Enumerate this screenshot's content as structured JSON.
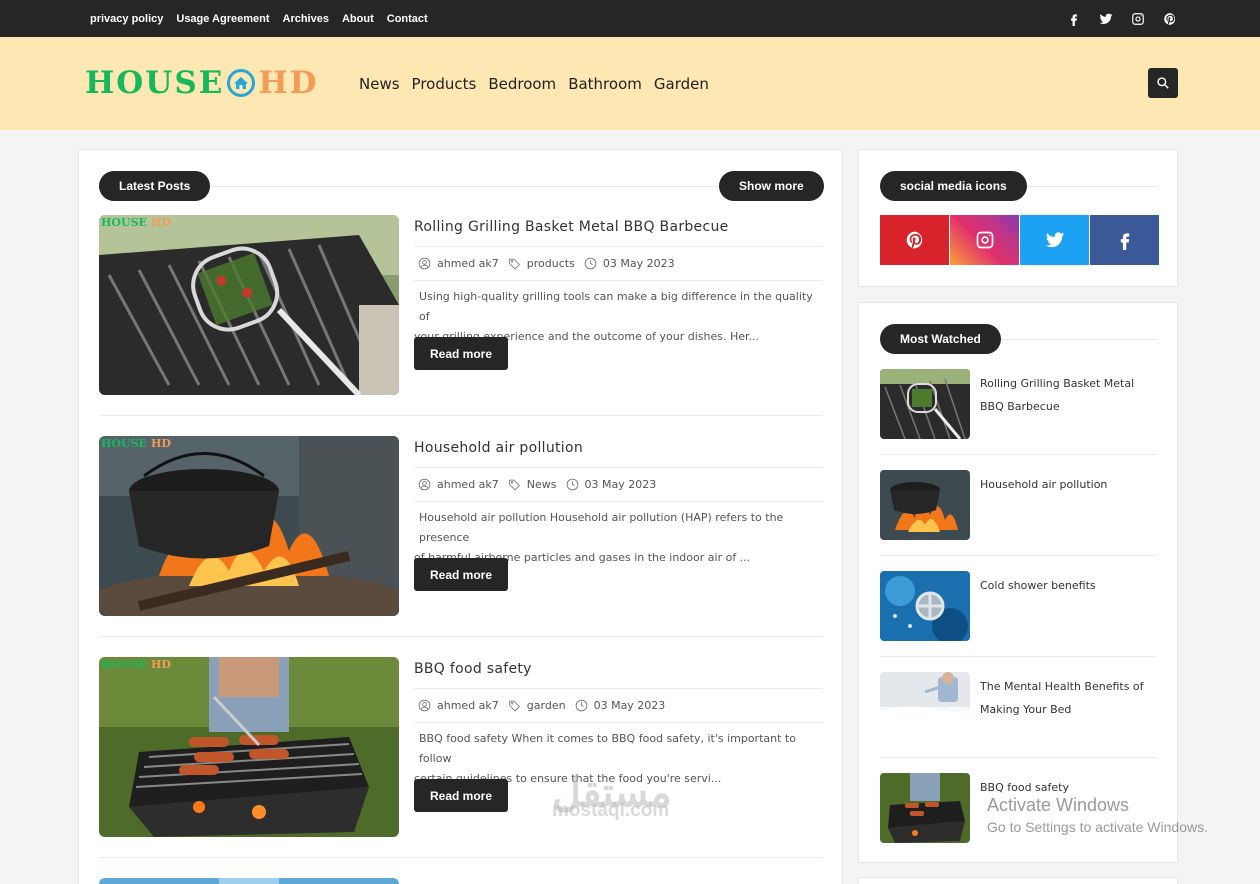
{
  "topbar": {
    "links": [
      "privacy policy",
      "Usage Agreement",
      "Archives",
      "About",
      "Contact"
    ],
    "social_icons": [
      "facebook-icon",
      "twitter-icon",
      "instagram-icon",
      "pinterest-icon"
    ]
  },
  "header": {
    "logo_left": "HOUSE",
    "logo_right": "HD",
    "nav": [
      "News",
      "Products",
      "Bedroom",
      "Bathroom",
      "Garden"
    ],
    "search_icon": "search-icon"
  },
  "latest": {
    "heading": "Latest Posts",
    "show_more": "Show more",
    "posts": [
      {
        "title": "Rolling Grilling Basket Metal BBQ Barbecue",
        "author": "ahmed ak7",
        "tag": "products",
        "date": "03 May 2023",
        "excerpt_1": "Using high-quality grilling tools can make a big difference in the quality of",
        "excerpt_2": "your grilling experience and the outcome of your dishes. Her...",
        "read": "Read more"
      },
      {
        "title": "Household air pollution",
        "author": "ahmed ak7",
        "tag": "News",
        "date": "03 May 2023",
        "excerpt_1": "Household air pollution Household air pollution (HAP) refers to the presence",
        "excerpt_2": "of harmful airborne particles and gases in the indoor air of ...",
        "read": "Read more"
      },
      {
        "title": "BBQ food safety",
        "author": "ahmed ak7",
        "tag": "garden",
        "date": "03 May 2023",
        "excerpt_1": "BBQ food safety When it comes to BBQ food safety, it's important to follow",
        "excerpt_2": "certain guidelines to ensure that the food you're servi...",
        "read": "Read more"
      }
    ]
  },
  "sidebar": {
    "social_heading": "social media icons",
    "social_colors": {
      "pinterest": "#d8232a",
      "instagram": "#c13584",
      "twitter": "#1da1f2",
      "facebook": "#3b5998"
    },
    "most_watched_heading": "Most Watched",
    "most_watched": [
      {
        "title_1": "Rolling Grilling Basket Metal",
        "title_2": "BBQ Barbecue"
      },
      {
        "title_1": "Household air pollution",
        "title_2": ""
      },
      {
        "title_1": "Cold shower benefits",
        "title_2": ""
      },
      {
        "title_1": "The Mental Health Benefits of",
        "title_2": "Making Your Bed"
      },
      {
        "title_1": "BBQ food safety",
        "title_2": ""
      }
    ]
  },
  "overlay": {
    "watermark_ar": "مستقل",
    "watermark": "mostaql.com",
    "activate_1": "Activate Windows",
    "activate_2": "Go to Settings to activate Windows."
  },
  "colors": {
    "dark": "#262626",
    "header_bg": "#fde8b4",
    "logo_green": "#16b85a",
    "logo_orange": "#f39c56"
  }
}
